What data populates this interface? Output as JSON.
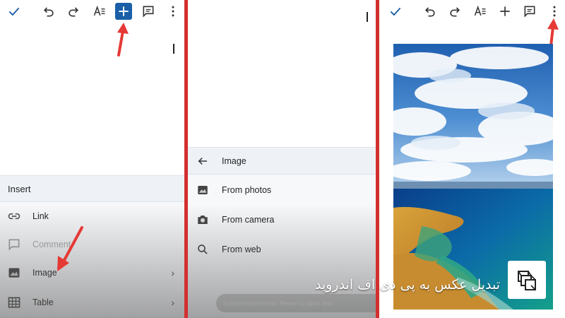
{
  "panel1": {
    "insert_title": "Insert",
    "items": [
      {
        "label": "Link",
        "icon": "link-icon",
        "chevron": ""
      },
      {
        "label": "Comment",
        "icon": "comment-icon",
        "chevron": ""
      },
      {
        "label": "Image",
        "icon": "image-icon",
        "chevron": "›"
      },
      {
        "label": "Table",
        "icon": "table-icon",
        "chevron": "›"
      }
    ]
  },
  "panel2": {
    "header": "Image",
    "sources": [
      {
        "label": "From photos",
        "icon": "photos-icon"
      },
      {
        "label": "From camera",
        "icon": "camera-icon"
      },
      {
        "label": "From web",
        "icon": "search-icon"
      }
    ],
    "toast": "Synchronisation error. Please try again later."
  },
  "caption": "تبدیل عکس به پی دی اف اندروید",
  "colors": {
    "accent": "#1a5fa8",
    "divider": "#d32f2f",
    "arrow": "#e53935"
  }
}
